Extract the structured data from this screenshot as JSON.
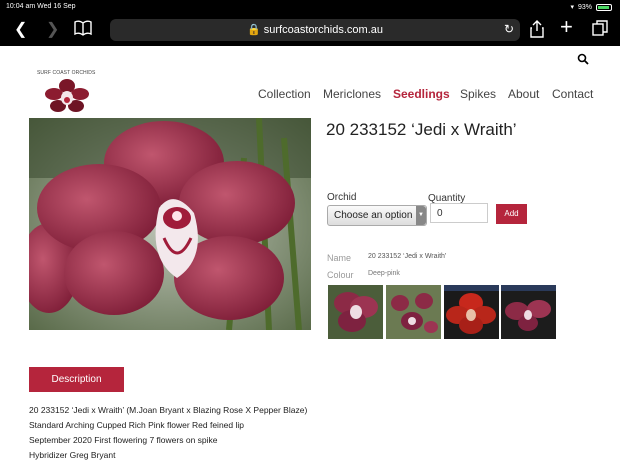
{
  "status_bar": {
    "time": "10:04 am  Wed 16 Sep",
    "battery": "93%"
  },
  "browser": {
    "url": "surfcoastorchids.com.au"
  },
  "site": {
    "logo_text": "SURF COAST ORCHIDS",
    "nav": [
      "Collection",
      "Mericlones",
      "Seedlings",
      "Spikes",
      "About",
      "Contact"
    ],
    "active_nav": "Seedlings"
  },
  "product": {
    "title": "20 233152 ‘Jedi x Wraith’",
    "orchid_label": "Orchid",
    "select_value": "Choose an option",
    "quantity_label": "Quantity",
    "quantity_value": "0",
    "add_label": "Add",
    "name_label": "Name",
    "name_value": "20 233152 ‘Jedi x Wraith’",
    "colour_label": "Colour",
    "colour_value": "Deep-pink"
  },
  "description": {
    "tab_label": "Description",
    "lines": [
      "20 233152 ‘Jedi x Wraith’ (M.Joan Bryant x Blazing Rose X Pepper Blaze)",
      "Standard Arching Cupped Rich Pink flower Red feined lip",
      "September 2020 First flowering 7 flowers on spike",
      "Hybridizer Greg Bryant"
    ]
  },
  "colors": {
    "accent": "#b5253c"
  }
}
